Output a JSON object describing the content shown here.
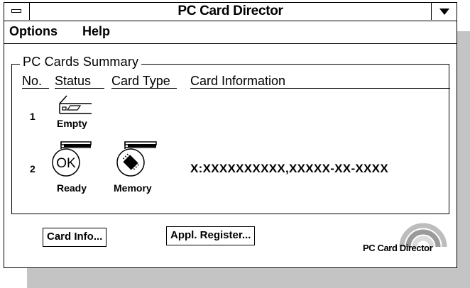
{
  "window": {
    "title": "PC Card Director"
  },
  "menu": {
    "options": "Options",
    "help": "Help"
  },
  "summary": {
    "group_title": "PC Cards Summary",
    "columns": {
      "no": "No.",
      "status": "Status",
      "card_type": "Card Type",
      "card_info": "Card Information"
    },
    "rows": [
      {
        "no": "1",
        "status_icon": "empty-slot-icon",
        "status_label": "Empty",
        "card_type": "",
        "card_info": ""
      },
      {
        "no": "2",
        "status_icon": "ok-icon",
        "status_label": "Ready",
        "status_icon_text": "OK",
        "card_type_icon": "memory-chip-icon",
        "card_type": "Memory",
        "card_info": "X:XXXXXXXXXX,XXXXX-XX-XXXX"
      }
    ]
  },
  "buttons": {
    "card_info": "Card Info...",
    "appl_register": "Appl. Register..."
  },
  "logo": {
    "text": "PC Card Director"
  }
}
